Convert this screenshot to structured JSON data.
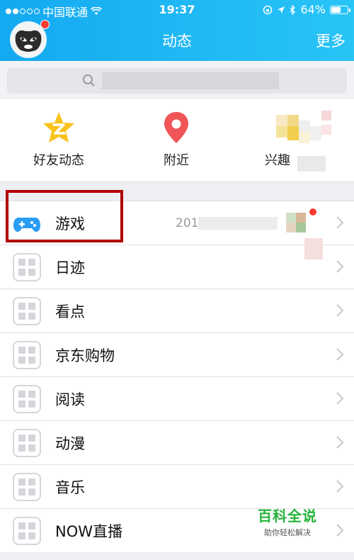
{
  "status_bar": {
    "carrier": "中国联通",
    "time": "19:37",
    "battery": "64%",
    "battery_level": 0.64
  },
  "header": {
    "title": "动态",
    "more_label": "更多"
  },
  "quick_actions": [
    {
      "label": "好友动态",
      "icon": "star-icon"
    },
    {
      "label": "附近",
      "icon": "location-pin-icon"
    },
    {
      "label": "兴趣",
      "icon": "interest-icon"
    }
  ],
  "game_row": {
    "label": "游戏",
    "detail": "201"
  },
  "list_items": [
    {
      "label": "日迹"
    },
    {
      "label": "看点"
    },
    {
      "label": "京东购物"
    },
    {
      "label": "阅读"
    },
    {
      "label": "动漫"
    },
    {
      "label": "音乐"
    },
    {
      "label": "NOW直播"
    }
  ],
  "watermark": {
    "main": "百科全说",
    "sub": "助你轻松解决"
  },
  "colors": {
    "header": "#1fb7f5",
    "highlight": "#b00000",
    "badge": "#ff3b30",
    "watermark": "#25b339"
  }
}
